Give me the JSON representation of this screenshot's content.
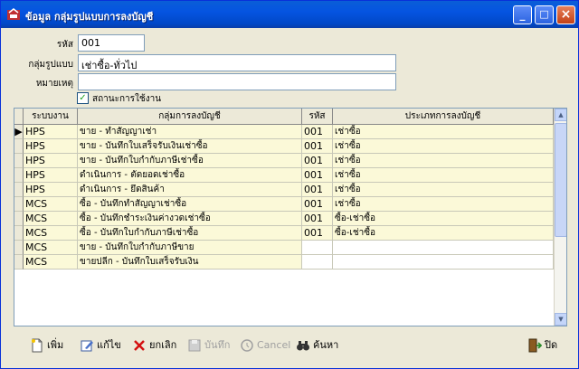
{
  "window": {
    "title": "ข้อมูล กลุ่มรูปแบบการลงบัญชี",
    "minimize": "_",
    "maximize": "□",
    "close": "×"
  },
  "form": {
    "code_label": "รหัส",
    "code_value": "001",
    "group_label": "กลุ่มรูปแบบ",
    "group_value": "เช่าซื้อ-ทั่วไป",
    "note_label": "หมายเหตุ",
    "note_value": "",
    "status_label": "สถานะการใช้งาน",
    "status_checked": "✓"
  },
  "grid": {
    "headers": [
      "ระบบงาน",
      "กลุ่มการลงบัญชี",
      "รหัส",
      "ประเภทการลงบัญชี"
    ],
    "current_row_marker": "▶",
    "rows": [
      {
        "system": "HPS",
        "group": "ขาย - ทำสัญญาเช่า",
        "code": "001",
        "type": "เช่าซื้อ"
      },
      {
        "system": "HPS",
        "group": "ขาย - บันทึกใบเสร็จรับเงินเช่าซื้อ",
        "code": "001",
        "type": "เช่าซื้อ"
      },
      {
        "system": "HPS",
        "group": "ขาย - บันทึกใบกำกับภาษีเช่าซื้อ",
        "code": "001",
        "type": "เช่าซื้อ"
      },
      {
        "system": "HPS",
        "group": "ดำเนินการ - ตัดยอดเช่าซื้อ",
        "code": "001",
        "type": "เช่าซื้อ"
      },
      {
        "system": "HPS",
        "group": "ดำเนินการ - ยึดสินค้า",
        "code": "001",
        "type": "เช่าซื้อ"
      },
      {
        "system": "MCS",
        "group": "ซื้อ - บันทึกทำสัญญาเช่าซื้อ",
        "code": "001",
        "type": "เช่าซื้อ"
      },
      {
        "system": "MCS",
        "group": "ซื้อ - บันทึกชำระเงินค่างวดเช่าซื้อ",
        "code": "001",
        "type": "ซื้อ-เช่าซื้อ"
      },
      {
        "system": "MCS",
        "group": "ซื้อ - บันทึกใบกำกับภาษีเช่าซื้อ",
        "code": "001",
        "type": "ซื้อ-เช่าซื้อ"
      },
      {
        "system": "MCS",
        "group": "ขาย - บันทึกใบกำกับภาษีขาย",
        "code": "",
        "type": ""
      },
      {
        "system": "MCS",
        "group": "ขายปลีก - บันทึกใบเสร็จรับเงิน",
        "code": "",
        "type": ""
      }
    ]
  },
  "toolbar": {
    "add": "เพิ่ม",
    "edit": "แก้ไข",
    "delete": "ยกเลิก",
    "save": "บันทึก",
    "cancel": "Cancel",
    "search": "ค้นหา",
    "close": "ปิด"
  },
  "colors": {
    "title_bar": "#0554e1",
    "window_bg": "#ece9d8",
    "row_bg": "#fbf9d8",
    "delete_red": "#d41010"
  }
}
